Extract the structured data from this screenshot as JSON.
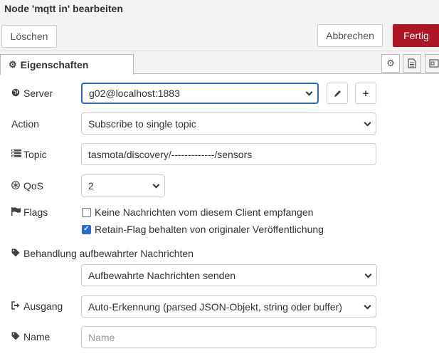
{
  "title": "Node 'mqtt in' bearbeiten",
  "actions": {
    "delete_label": "Löschen",
    "cancel_label": "Abbrechen",
    "done_label": "Fertig"
  },
  "tabs": {
    "active_label": "Eigenschaften",
    "icons": [
      "gear-icon",
      "document-icon",
      "layout-icon"
    ]
  },
  "form": {
    "server": {
      "label": "Server",
      "value": "g02@localhost:1883",
      "edit_icon": "pencil-icon",
      "add_icon": "plus-icon"
    },
    "action": {
      "label": "Action",
      "value": "Subscribe to single topic"
    },
    "topic": {
      "label": "Topic",
      "value": "tasmota/discovery/-------------/sensors"
    },
    "qos": {
      "label": "QoS",
      "value": "2"
    },
    "flags": {
      "label": "Flags",
      "options": [
        {
          "label": "Keine Nachrichten vom diesem Client empfangen",
          "checked": false
        },
        {
          "label": "Retain-Flag behalten von originaler Veröffentlichung",
          "checked": true
        }
      ]
    },
    "retained": {
      "label": "Behandlung aufbewahrter Nachrichten",
      "value": "Aufbewahrte Nachrichten senden"
    },
    "output": {
      "label": "Ausgang",
      "value": "Auto-Erkennung (parsed JSON-Objekt, string oder buffer)"
    },
    "name": {
      "label": "Name",
      "placeholder": "Name",
      "value": ""
    }
  },
  "colors": {
    "primary_button": "#ad1625",
    "focus_border": "#2b6bd6"
  }
}
